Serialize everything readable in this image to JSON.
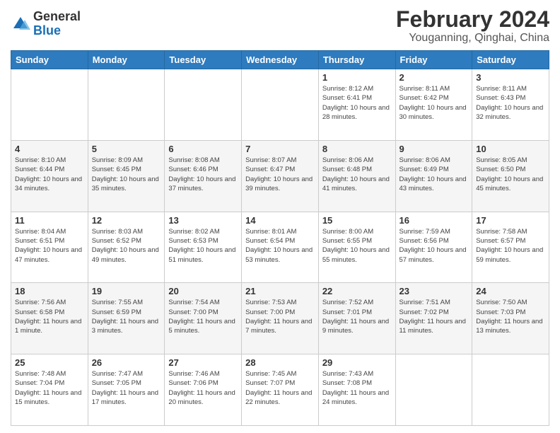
{
  "logo": {
    "general": "General",
    "blue": "Blue"
  },
  "header": {
    "title": "February 2024",
    "subtitle": "Youganning, Qinghai, China"
  },
  "weekdays": [
    "Sunday",
    "Monday",
    "Tuesday",
    "Wednesday",
    "Thursday",
    "Friday",
    "Saturday"
  ],
  "weeks": [
    [
      {
        "day": "",
        "info": ""
      },
      {
        "day": "",
        "info": ""
      },
      {
        "day": "",
        "info": ""
      },
      {
        "day": "",
        "info": ""
      },
      {
        "day": "1",
        "info": "Sunrise: 8:12 AM\nSunset: 6:41 PM\nDaylight: 10 hours and 28 minutes."
      },
      {
        "day": "2",
        "info": "Sunrise: 8:11 AM\nSunset: 6:42 PM\nDaylight: 10 hours and 30 minutes."
      },
      {
        "day": "3",
        "info": "Sunrise: 8:11 AM\nSunset: 6:43 PM\nDaylight: 10 hours and 32 minutes."
      }
    ],
    [
      {
        "day": "4",
        "info": "Sunrise: 8:10 AM\nSunset: 6:44 PM\nDaylight: 10 hours and 34 minutes."
      },
      {
        "day": "5",
        "info": "Sunrise: 8:09 AM\nSunset: 6:45 PM\nDaylight: 10 hours and 35 minutes."
      },
      {
        "day": "6",
        "info": "Sunrise: 8:08 AM\nSunset: 6:46 PM\nDaylight: 10 hours and 37 minutes."
      },
      {
        "day": "7",
        "info": "Sunrise: 8:07 AM\nSunset: 6:47 PM\nDaylight: 10 hours and 39 minutes."
      },
      {
        "day": "8",
        "info": "Sunrise: 8:06 AM\nSunset: 6:48 PM\nDaylight: 10 hours and 41 minutes."
      },
      {
        "day": "9",
        "info": "Sunrise: 8:06 AM\nSunset: 6:49 PM\nDaylight: 10 hours and 43 minutes."
      },
      {
        "day": "10",
        "info": "Sunrise: 8:05 AM\nSunset: 6:50 PM\nDaylight: 10 hours and 45 minutes."
      }
    ],
    [
      {
        "day": "11",
        "info": "Sunrise: 8:04 AM\nSunset: 6:51 PM\nDaylight: 10 hours and 47 minutes."
      },
      {
        "day": "12",
        "info": "Sunrise: 8:03 AM\nSunset: 6:52 PM\nDaylight: 10 hours and 49 minutes."
      },
      {
        "day": "13",
        "info": "Sunrise: 8:02 AM\nSunset: 6:53 PM\nDaylight: 10 hours and 51 minutes."
      },
      {
        "day": "14",
        "info": "Sunrise: 8:01 AM\nSunset: 6:54 PM\nDaylight: 10 hours and 53 minutes."
      },
      {
        "day": "15",
        "info": "Sunrise: 8:00 AM\nSunset: 6:55 PM\nDaylight: 10 hours and 55 minutes."
      },
      {
        "day": "16",
        "info": "Sunrise: 7:59 AM\nSunset: 6:56 PM\nDaylight: 10 hours and 57 minutes."
      },
      {
        "day": "17",
        "info": "Sunrise: 7:58 AM\nSunset: 6:57 PM\nDaylight: 10 hours and 59 minutes."
      }
    ],
    [
      {
        "day": "18",
        "info": "Sunrise: 7:56 AM\nSunset: 6:58 PM\nDaylight: 11 hours and 1 minute."
      },
      {
        "day": "19",
        "info": "Sunrise: 7:55 AM\nSunset: 6:59 PM\nDaylight: 11 hours and 3 minutes."
      },
      {
        "day": "20",
        "info": "Sunrise: 7:54 AM\nSunset: 7:00 PM\nDaylight: 11 hours and 5 minutes."
      },
      {
        "day": "21",
        "info": "Sunrise: 7:53 AM\nSunset: 7:00 PM\nDaylight: 11 hours and 7 minutes."
      },
      {
        "day": "22",
        "info": "Sunrise: 7:52 AM\nSunset: 7:01 PM\nDaylight: 11 hours and 9 minutes."
      },
      {
        "day": "23",
        "info": "Sunrise: 7:51 AM\nSunset: 7:02 PM\nDaylight: 11 hours and 11 minutes."
      },
      {
        "day": "24",
        "info": "Sunrise: 7:50 AM\nSunset: 7:03 PM\nDaylight: 11 hours and 13 minutes."
      }
    ],
    [
      {
        "day": "25",
        "info": "Sunrise: 7:48 AM\nSunset: 7:04 PM\nDaylight: 11 hours and 15 minutes."
      },
      {
        "day": "26",
        "info": "Sunrise: 7:47 AM\nSunset: 7:05 PM\nDaylight: 11 hours and 17 minutes."
      },
      {
        "day": "27",
        "info": "Sunrise: 7:46 AM\nSunset: 7:06 PM\nDaylight: 11 hours and 20 minutes."
      },
      {
        "day": "28",
        "info": "Sunrise: 7:45 AM\nSunset: 7:07 PM\nDaylight: 11 hours and 22 minutes."
      },
      {
        "day": "29",
        "info": "Sunrise: 7:43 AM\nSunset: 7:08 PM\nDaylight: 11 hours and 24 minutes."
      },
      {
        "day": "",
        "info": ""
      },
      {
        "day": "",
        "info": ""
      }
    ]
  ]
}
